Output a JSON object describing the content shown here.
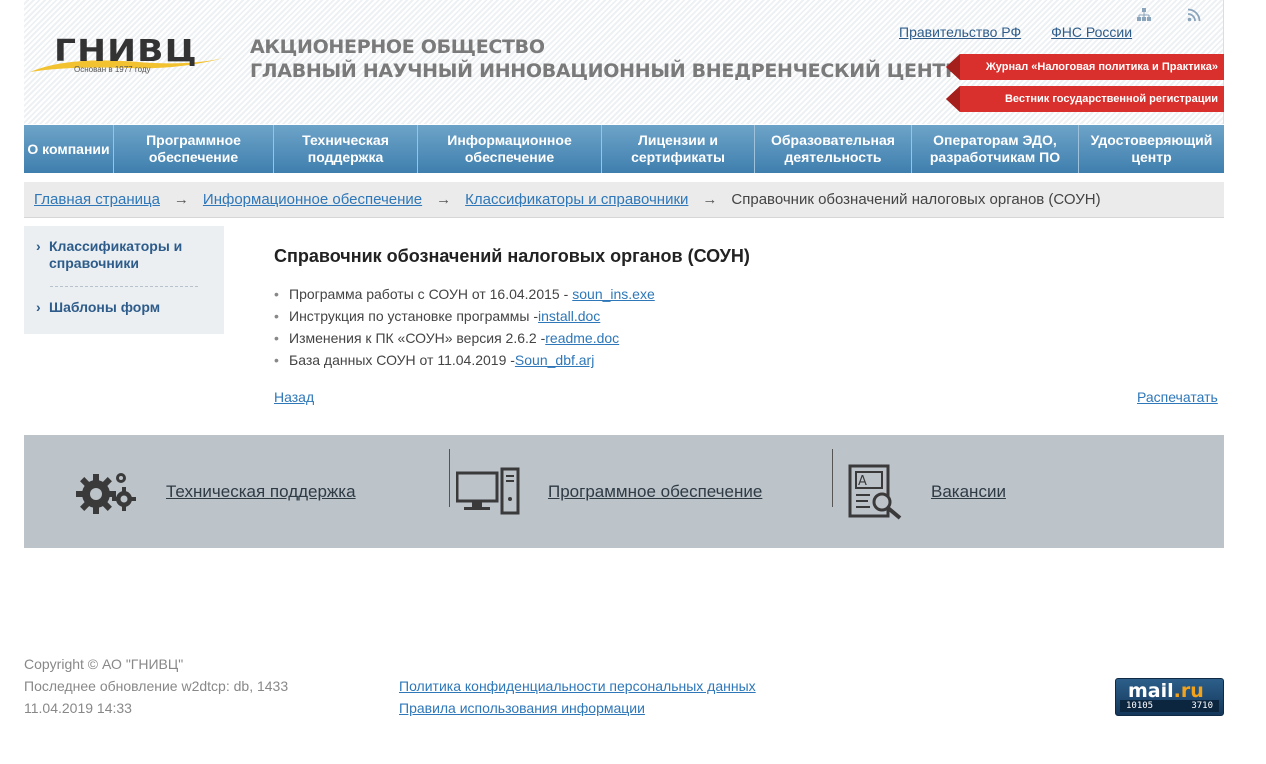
{
  "header": {
    "logo_text": "ГНИВЦ",
    "logo_subtitle": "Основан в 1977 году",
    "company_line1": "АКЦИОНЕРНОЕ ОБЩЕСТВО",
    "company_line2": "ГЛАВНЫЙ НАУЧНЫЙ ИННОВАЦИОННЫЙ ВНЕДРЕНЧЕСКИЙ ЦЕНТР",
    "top_links": [
      "Правительство РФ",
      "ФНС России"
    ],
    "banners": [
      "Журнал «Налоговая политика и Практика»",
      "Вестник государственной регистрации"
    ],
    "icons": [
      "sitemap-icon",
      "rss-icon"
    ],
    "accent_color": "#d9302d"
  },
  "nav": {
    "items": [
      "О компании",
      "Программное обеспечение",
      "Техническая поддержка",
      "Информационное обеспечение",
      "Лицензии и сертификаты",
      "Образовательная деятельность",
      "Операторам ЭДО, разработчикам ПО",
      "Удостоверяющий центр"
    ],
    "color": "#4a87b5"
  },
  "breadcrumb": {
    "items": [
      "Главная страница",
      "Информационное обеспечение",
      "Классификаторы и справочники"
    ],
    "separator": "→",
    "current": "Справочник обозначений налоговых органов (СОУН)"
  },
  "sidebar": {
    "items": [
      "Классификаторы и справочники",
      "Шаблоны форм"
    ],
    "chevron": "›"
  },
  "main": {
    "title": "Справочник обозначений налоговых органов (СОУН)",
    "files": [
      {
        "text": "Программа работы с СОУН от 16.04.2015 - ",
        "link": "soun_ins.exe"
      },
      {
        "text": "Инструкция по установке программы - ",
        "link": "install.doc"
      },
      {
        "text": "Изменения к ПК «СОУН» версия 2.6.2 - ",
        "link": "readme.doc"
      },
      {
        "text": "База данных СОУН от 11.04.2019 - ",
        "link": "Soun_dbf.arj"
      }
    ],
    "back_label": "Назад",
    "print_label": "Распечатать"
  },
  "bottom_panel": {
    "items": [
      {
        "label": "Техническая поддержка",
        "icon": "gears-icon"
      },
      {
        "label": "Программное обеспечение",
        "icon": "computer-icon"
      },
      {
        "label": "Вакансии",
        "icon": "document-search-icon"
      }
    ]
  },
  "footer": {
    "copyright": "Copyright © АО \"ГНИВЦ\"",
    "update_line": "Последнее обновление w2dtcp: db, 1433",
    "date": "11.04.2019 14:33",
    "links": [
      "Политика конфиденциальности персональных данных",
      "Правила использования информации"
    ],
    "counter": {
      "logo_main": "mail",
      "logo_accent": ".ru",
      "value1": "10105",
      "value2": "3710"
    }
  }
}
